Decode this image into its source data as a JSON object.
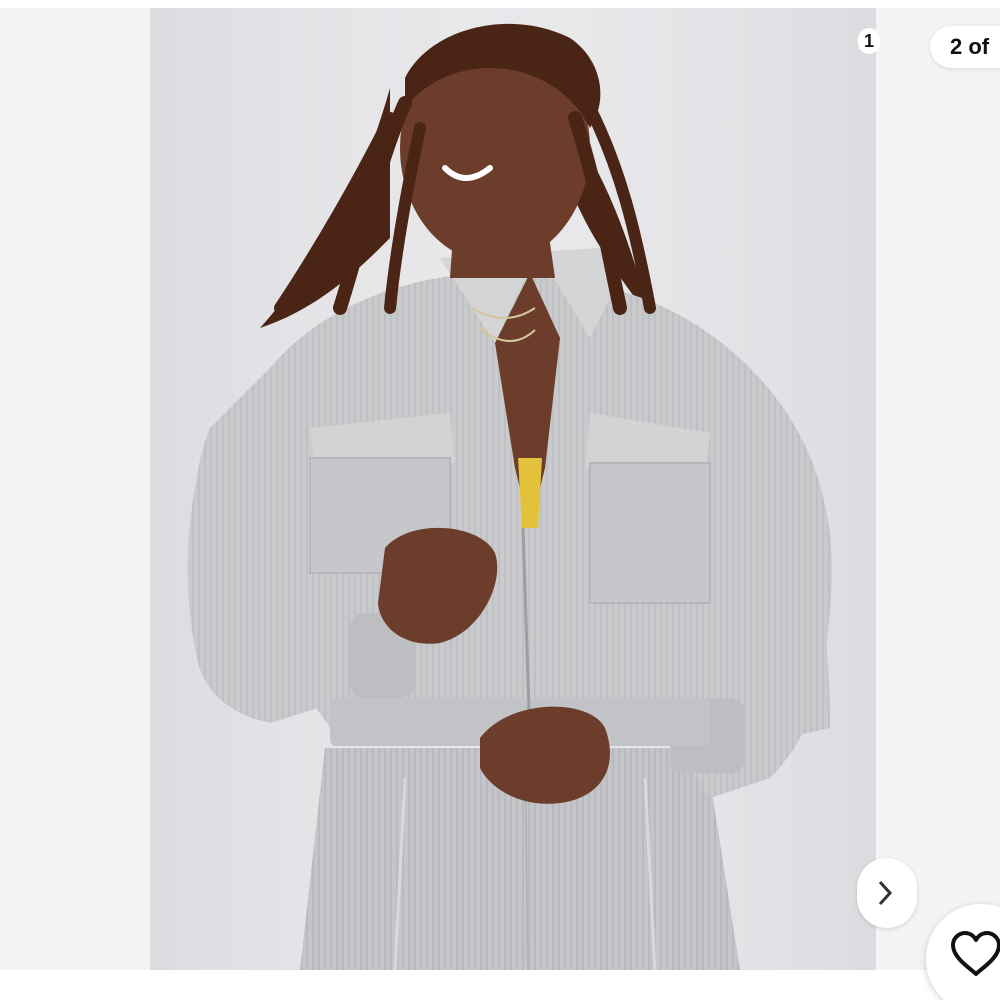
{
  "viewer": {
    "counter_small": "1",
    "counter_badge": "2 of",
    "icons": {
      "next": "chevron-right-icon",
      "like": "heart-outline-icon"
    },
    "colors": {
      "backdrop": "#e6e6e9",
      "jacket": "#c9cacc",
      "skin": "#6b3d2a",
      "hair": "#4a2516",
      "top": "#e3c13a"
    }
  }
}
